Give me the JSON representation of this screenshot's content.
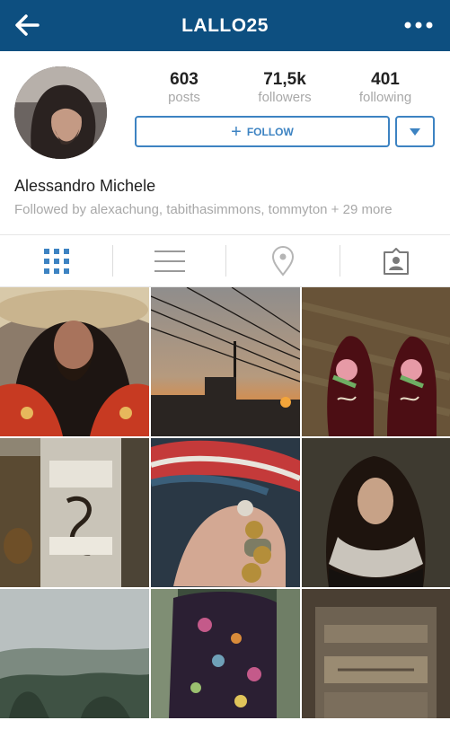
{
  "header": {
    "username": "LALLO25",
    "back_icon": "arrow-left-icon",
    "more_icon": "more-dots-icon",
    "bar_color": "#0d4f80"
  },
  "profile": {
    "full_name": "Alessandro Michele",
    "followed_by": "Followed by alexachung, tabithasimmons, tommyton + 29 more",
    "stats": [
      {
        "value": "603",
        "label": "posts"
      },
      {
        "value": "71,5k",
        "label": "followers"
      },
      {
        "value": "401",
        "label": "following"
      }
    ],
    "follow_label": "FOLLOW",
    "accent_color": "#3d83c2"
  },
  "tabs": [
    {
      "name": "grid-view",
      "icon": "grid-icon",
      "active": true
    },
    {
      "name": "list-view",
      "icon": "list-icon",
      "active": false
    },
    {
      "name": "map-view",
      "icon": "location-pin-icon",
      "active": false
    },
    {
      "name": "tagged-photos",
      "icon": "tagged-person-icon",
      "active": false
    }
  ]
}
